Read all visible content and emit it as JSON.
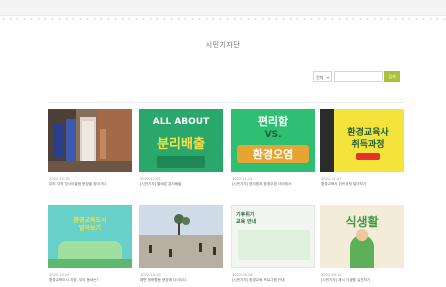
{
  "page": {
    "title": "시민기자단"
  },
  "search": {
    "select_value": "전체",
    "button_label": "검색"
  },
  "cards": [
    {
      "date": "2022.12.19",
      "title": "우리 지역 업사이클링 현장을 찾아가다",
      "thumb_text": ""
    },
    {
      "date": "2022.12.05",
      "title": "[시민기자] 올바른 분리배출",
      "thumb_text_top": "ALL ABOUT",
      "thumb_text_main": "분리배출"
    },
    {
      "date": "2022.11.21",
      "title": "[시민기자] 편리함과 환경오염 사이에서",
      "thumb_text_top": "편리함",
      "thumb_text_mid": "VS.",
      "thumb_text_main": "환경오염"
    },
    {
      "date": "2022.11.07",
      "title": "환경교육사 취득과정 알아보기",
      "thumb_text_top": "환경교육사",
      "thumb_text_main": "취득과정"
    },
    {
      "date": "2022.10.24",
      "title": "환경교육도시 지정, 우리 동네는?",
      "thumb_text_top": "환경교육도시",
      "thumb_text_main": "알아보기"
    },
    {
      "date": "2022.10.10",
      "title": "해변 정화활동 현장에 다녀오다",
      "thumb_text": ""
    },
    {
      "date": "2022.09.26",
      "title": "[시민기자] 환경교육 프로그램 안내",
      "thumb_text_top": "기후위기",
      "thumb_text_main": "교육 안내"
    },
    {
      "date": "2022.09.12",
      "title": "[시민기자] 채식 식생활 실천하기",
      "thumb_text_main": "식생활"
    }
  ],
  "colors": {
    "accent": "#a9c23a",
    "green_thumb": "#2aa86b",
    "yellow_thumb": "#f4e33a",
    "teal_thumb": "#67d0c8"
  }
}
